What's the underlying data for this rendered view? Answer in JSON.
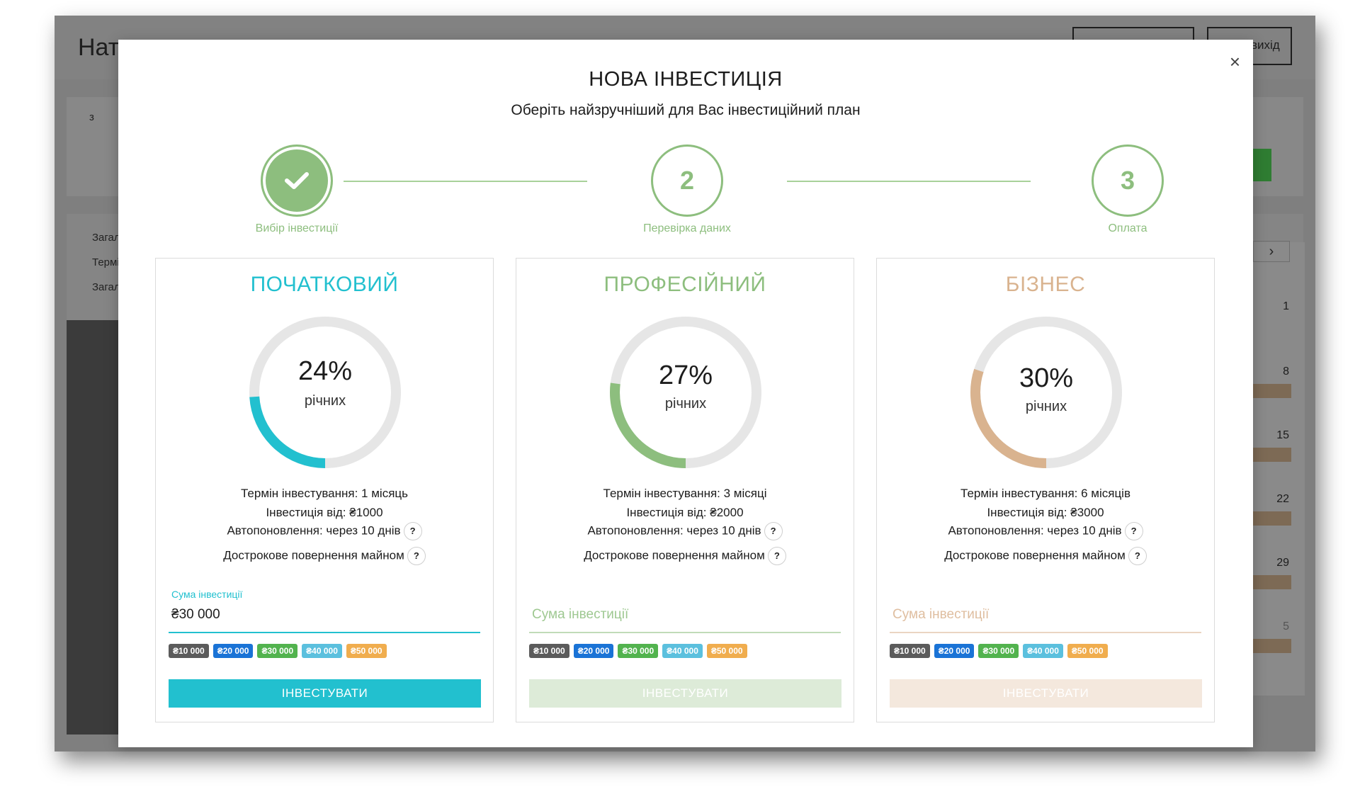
{
  "app": {
    "title": "Нат",
    "header_buttons": [
      "",
      "вихід"
    ],
    "panel_label": "з",
    "summary_labels": [
      "Загалы",
      "Термін",
      "Загалы"
    ],
    "calendar": {
      "next_icon": "chevron-right-icon",
      "days": [
        "1",
        "8",
        "15",
        "22",
        "29",
        "5"
      ]
    }
  },
  "modal": {
    "title": "НОВА ІНВЕСТИЦІЯ",
    "subtitle": "Оберіть найзручніший для Вас інвестиційний план",
    "close_label": "×",
    "steps": [
      {
        "label": "Вибір інвестиції",
        "number": "",
        "state": "done"
      },
      {
        "label": "Перевірка даних",
        "number": "2",
        "state": "pending"
      },
      {
        "label": "Оплата",
        "number": "3",
        "state": "pending"
      }
    ],
    "plans": [
      {
        "name": "ПОЧАТКОВИЙ",
        "color": "#22c0cf",
        "rate_pct": "24%",
        "rate_value": 24,
        "rate_unit": "річних",
        "term": "Термін інвестування: 1 місяць",
        "min": "Інвестиція від: ₴1000",
        "auto": "Автопоновлення: через 10 днів",
        "early": "Дострокове повернення майном",
        "amount_label": "Сума інвестиції",
        "amount_value": "₴30 000",
        "amount_placeholder": "",
        "button": "ІНВЕСТУВАТИ",
        "button_enabled": true
      },
      {
        "name": "ПРОФЕСІЙНИЙ",
        "color": "#8dbe7e",
        "rate_pct": "27%",
        "rate_value": 27,
        "rate_unit": "річних",
        "term": "Термін інвестування: 3 місяці",
        "min": "Інвестиція від: ₴2000",
        "auto": "Автопоновлення: через 10 днів",
        "early": "Дострокове повернення майном",
        "amount_label": "",
        "amount_value": "",
        "amount_placeholder": "Сума інвестиції",
        "button": "ІНВЕСТУВАТИ",
        "button_enabled": false
      },
      {
        "name": "БІЗНЕС",
        "color": "#d9b38f",
        "rate_pct": "30%",
        "rate_value": 30,
        "rate_unit": "річних",
        "term": "Термін інвестування: 6 місяців",
        "min": "Інвестиція від: ₴3000",
        "auto": "Автопоновлення: через 10 днів",
        "early": "Дострокове повернення майном",
        "amount_label": "",
        "amount_value": "",
        "amount_placeholder": "Сума інвестиції",
        "button": "ІНВЕСТУВАТИ",
        "button_enabled": false
      }
    ],
    "chips": [
      {
        "label": "₴10 000",
        "color": "#5b5b5b"
      },
      {
        "label": "₴20 000",
        "color": "#1a73d6"
      },
      {
        "label": "₴30 000",
        "color": "#52b34e"
      },
      {
        "label": "₴40 000",
        "color": "#5bc0de"
      },
      {
        "label": "₴50 000",
        "color": "#f0ad4e"
      }
    ],
    "help_icon": "?"
  }
}
